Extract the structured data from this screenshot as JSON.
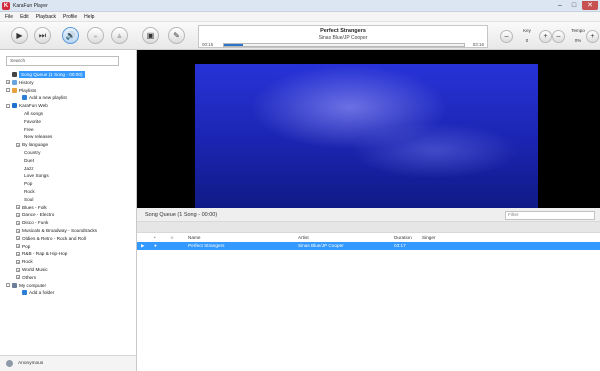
{
  "window": {
    "title": "KaraFun Player",
    "minimize": "–",
    "maximize": "□",
    "close": "✕",
    "app_icon": "K"
  },
  "menu": [
    "File",
    "Edit",
    "Playback",
    "Profile",
    "Help"
  ],
  "toolbar": {
    "icons": {
      "play": "▶",
      "next": "⏭",
      "vocals": "🔊",
      "mic": "◒",
      "metronome": "▲",
      "fullscreen": "▣",
      "settings": "✎"
    },
    "now_playing": {
      "title": "Perfect Strangers",
      "artist": "Sinas Blue/JP Cooper",
      "elapsed": "00:15",
      "total": "03:16",
      "progress": 0.08
    },
    "key": {
      "label": "Key",
      "value": "0",
      "minus": "–",
      "plus": "+"
    },
    "tempo": {
      "label": "Tempo",
      "value": "0%",
      "minus": "–",
      "plus": "+"
    }
  },
  "sidebar": {
    "search_placeholder": "Search",
    "tree": [
      {
        "label": "Song Queue (1 Song - 00:00)",
        "selected": true,
        "expander": "",
        "icon": "#444444"
      },
      {
        "label": "History",
        "expander": "+",
        "icon": "#6aa5e0"
      },
      {
        "label": "Playlists",
        "expander": "–",
        "icon": "#e6a23c"
      },
      {
        "label": "Add a new playlist",
        "expander": "",
        "icon": "#2c7fd6"
      },
      {
        "label": "KaraFun Web",
        "expander": "–",
        "icon": "#1f6fd1"
      },
      {
        "label": "All songs"
      },
      {
        "label": "Favorite"
      },
      {
        "label": "Free"
      },
      {
        "label": "New releases"
      },
      {
        "label": "By language",
        "expander": "+"
      },
      {
        "label": "Country"
      },
      {
        "label": "Duet"
      },
      {
        "label": "Jazz"
      },
      {
        "label": "Love Songs"
      },
      {
        "label": "Pop"
      },
      {
        "label": "Rock"
      },
      {
        "label": "Soul"
      },
      {
        "label": "Blues - Folk",
        "expander": "+"
      },
      {
        "label": "Dance - Electro",
        "expander": "+"
      },
      {
        "label": "Disco - Funk",
        "expander": "+"
      },
      {
        "label": "Musicals & Broadway - Soundtracks",
        "expander": "+"
      },
      {
        "label": "Oldies & Retro - Rock and Roll",
        "expander": "+"
      },
      {
        "label": "Pop",
        "expander": "+"
      },
      {
        "label": "R&B - Rap & Hip-Hop",
        "expander": "+"
      },
      {
        "label": "Rock",
        "expander": "+"
      },
      {
        "label": "World Music",
        "expander": "+"
      },
      {
        "label": "Others",
        "expander": "+"
      },
      {
        "label": "My computer",
        "expander": "–",
        "icon": "#6b7f99"
      },
      {
        "label": "Add a folder",
        "expander": "",
        "icon": "#2c7fd6"
      }
    ],
    "user": "Anonymous"
  },
  "queue": {
    "title": "Song Queue (1 Song - 00:00)",
    "filter_placeholder": "Filter",
    "columns": {
      "type": "◔",
      "fav": "☆",
      "name": "Name",
      "artist": "Artist",
      "duration": "Duration",
      "singer": "Singer"
    },
    "rows": [
      {
        "playing": "▶",
        "dot": "●",
        "name": "Perfect Strangers",
        "artist": "Sinas Blue/JP Cooper",
        "duration": "03:17",
        "singer": ""
      }
    ]
  }
}
